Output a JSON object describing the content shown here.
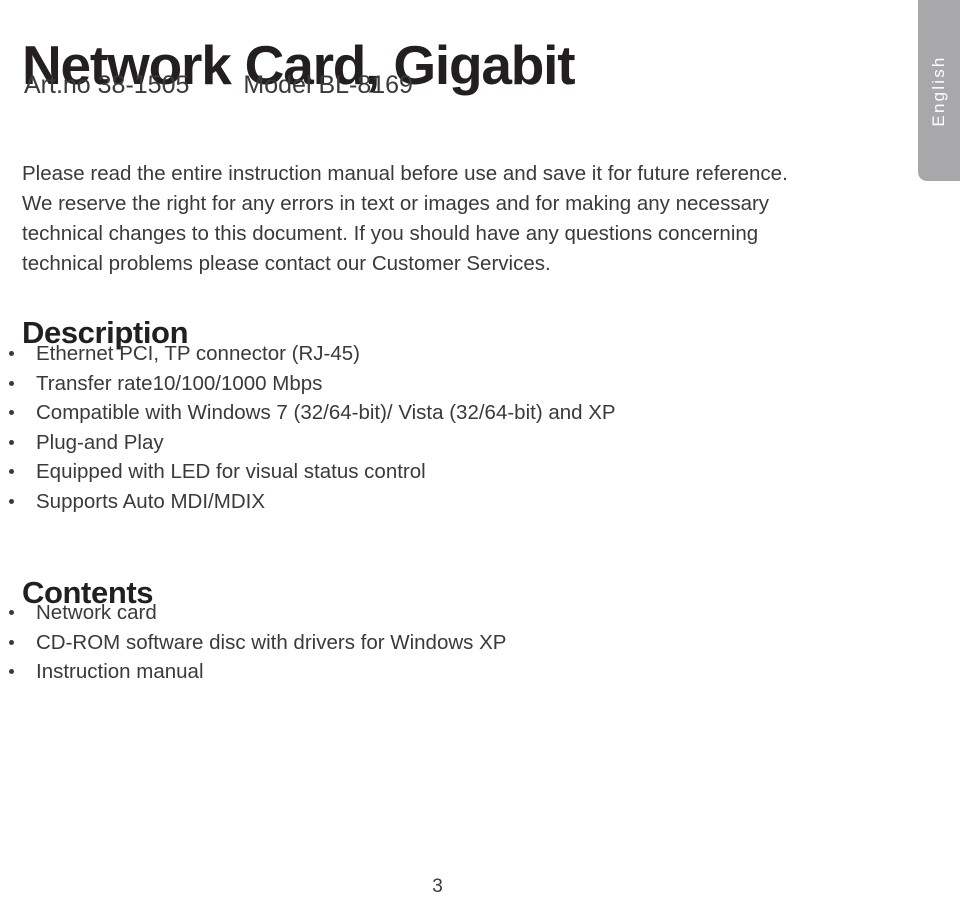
{
  "document": {
    "title": "Network Card, Gigabit",
    "article_number_label": "Art.no 38-1505",
    "model_label": "Model  BL-8169",
    "intro_paragraph": "Please read the entire instruction manual before use and save it for future reference. We reserve the right for any errors in text or images and for making any necessary technical changes to this document. If you should have any questions concerning technical problems please contact our Customer Services.",
    "page_number": "3"
  },
  "language_tab": {
    "label": "English",
    "background_color": "#a8a8aa",
    "text_color": "#ffffff"
  },
  "sections": [
    {
      "heading": "Description",
      "items": [
        "Ethernet PCI, TP connector (RJ-45)",
        "Transfer rate10/100/1000 Mbps",
        "Compatible with Windows 7 (32/64-bit)/ Vista (32/64-bit) and XP",
        "Plug-and Play",
        "Equipped with LED for visual status control",
        "Supports Auto MDI/MDIX"
      ]
    },
    {
      "heading": "Contents",
      "items": [
        "Network card",
        "CD-ROM software disc with drivers for Windows XP",
        "Instruction manual"
      ]
    }
  ],
  "colors": {
    "text": "#231f20",
    "body_text": "#3a3a3a",
    "background": "#ffffff",
    "tab_gray": "#a8a8aa"
  }
}
